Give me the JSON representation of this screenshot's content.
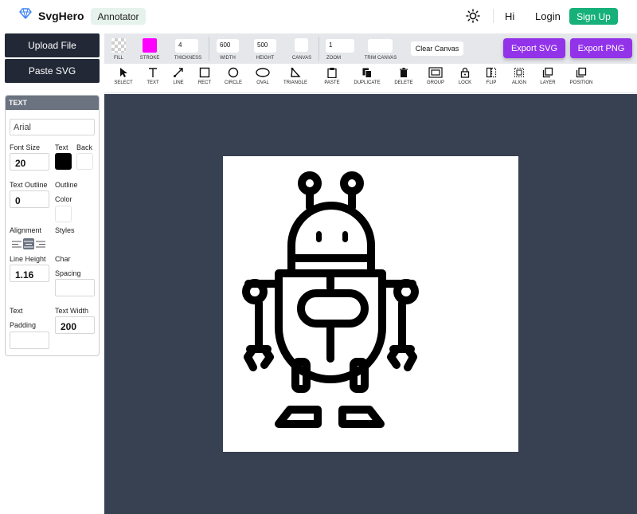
{
  "header": {
    "brand": "SvgHero",
    "annotator_label": "Annotator",
    "greeting": "Hi",
    "login_label": "Login",
    "signup_label": "Sign Up",
    "accent_color": "#16b07a"
  },
  "sidebar": {
    "upload_label": "Upload File",
    "paste_label": "Paste SVG"
  },
  "text_panel": {
    "title": "TEXT",
    "font_value": "Arial",
    "font_size_label": "Font Size",
    "font_size_value": "20",
    "text_label": "Text",
    "back_label": "Back",
    "outline_label": "Text Outline",
    "outline_value": "0",
    "outline_color_label_1": "Outline",
    "outline_color_label_2": "Color",
    "alignment_label": "Alignment",
    "styles_label": "Styles",
    "line_height_label": "Line Height",
    "line_height_value": "1.16",
    "char_label_1": "Char",
    "char_label_2": "Spacing",
    "padding_label_1": "Text",
    "padding_label_2": "Padding",
    "text_width_label": "Text Width",
    "text_width_value": "200",
    "text_color": "#000000",
    "back_color": "#ffffff"
  },
  "toolbar": {
    "fill_label": "FILL",
    "stroke_label": "STROKE",
    "stroke_color": "#ff00ff",
    "thickness_label": "THICKNESS",
    "thickness_value": "4",
    "width_label": "WIDTH",
    "width_value": "600",
    "height_label": "HEIGHT",
    "height_value": "500",
    "canvas_label": "CANVAS",
    "zoom_label": "ZOOM",
    "zoom_value": "1",
    "trim_label": "TRIM CANVAS",
    "clear_label": "Clear Canvas",
    "export_svg_label": "Export SVG",
    "export_png_label": "Export PNG",
    "export_color": "#9233ea"
  },
  "tools": [
    {
      "label": "SELECT",
      "icon": "cursor-icon"
    },
    {
      "label": "TEXT",
      "icon": "text-icon"
    },
    {
      "label": "LINE",
      "icon": "line-icon"
    },
    {
      "label": "RECT",
      "icon": "rect-icon"
    },
    {
      "label": "CIRCLE",
      "icon": "circle-icon"
    },
    {
      "label": "OVAL",
      "icon": "oval-icon"
    },
    {
      "label": "TRIANGLE",
      "icon": "triangle-icon"
    },
    {
      "label": "PASTE",
      "icon": "clipboard-icon"
    },
    {
      "label": "DUPLICATE",
      "icon": "duplicate-icon"
    },
    {
      "label": "DELETE",
      "icon": "trash-icon"
    },
    {
      "label": "GROUP",
      "icon": "group-icon"
    },
    {
      "label": "LOCK",
      "icon": "lock-icon"
    },
    {
      "label": "FLIP",
      "icon": "flip-icon"
    },
    {
      "label": "ALIGN",
      "icon": "align-icon"
    },
    {
      "label": "LAYER",
      "icon": "layer-icon"
    },
    {
      "label": "POSITION",
      "icon": "position-icon"
    }
  ],
  "canvas": {
    "background_color": "#384152",
    "page_color": "#ffffff",
    "artwork": "robot-illustration"
  }
}
